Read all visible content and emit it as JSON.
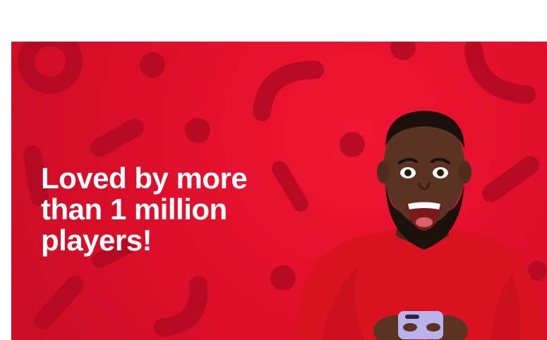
{
  "banner": {
    "headline_lines": [
      "Loved by more",
      "than 1 million",
      "players!"
    ],
    "background_color": "#e10f2b",
    "shape_color": "#b00a22",
    "text_color": "#ffffff"
  },
  "illustration": {
    "subject": "excited man in red sweater holding smartphone",
    "sweater_color": "#d9121f",
    "phone_color": "#b9b2ea"
  }
}
